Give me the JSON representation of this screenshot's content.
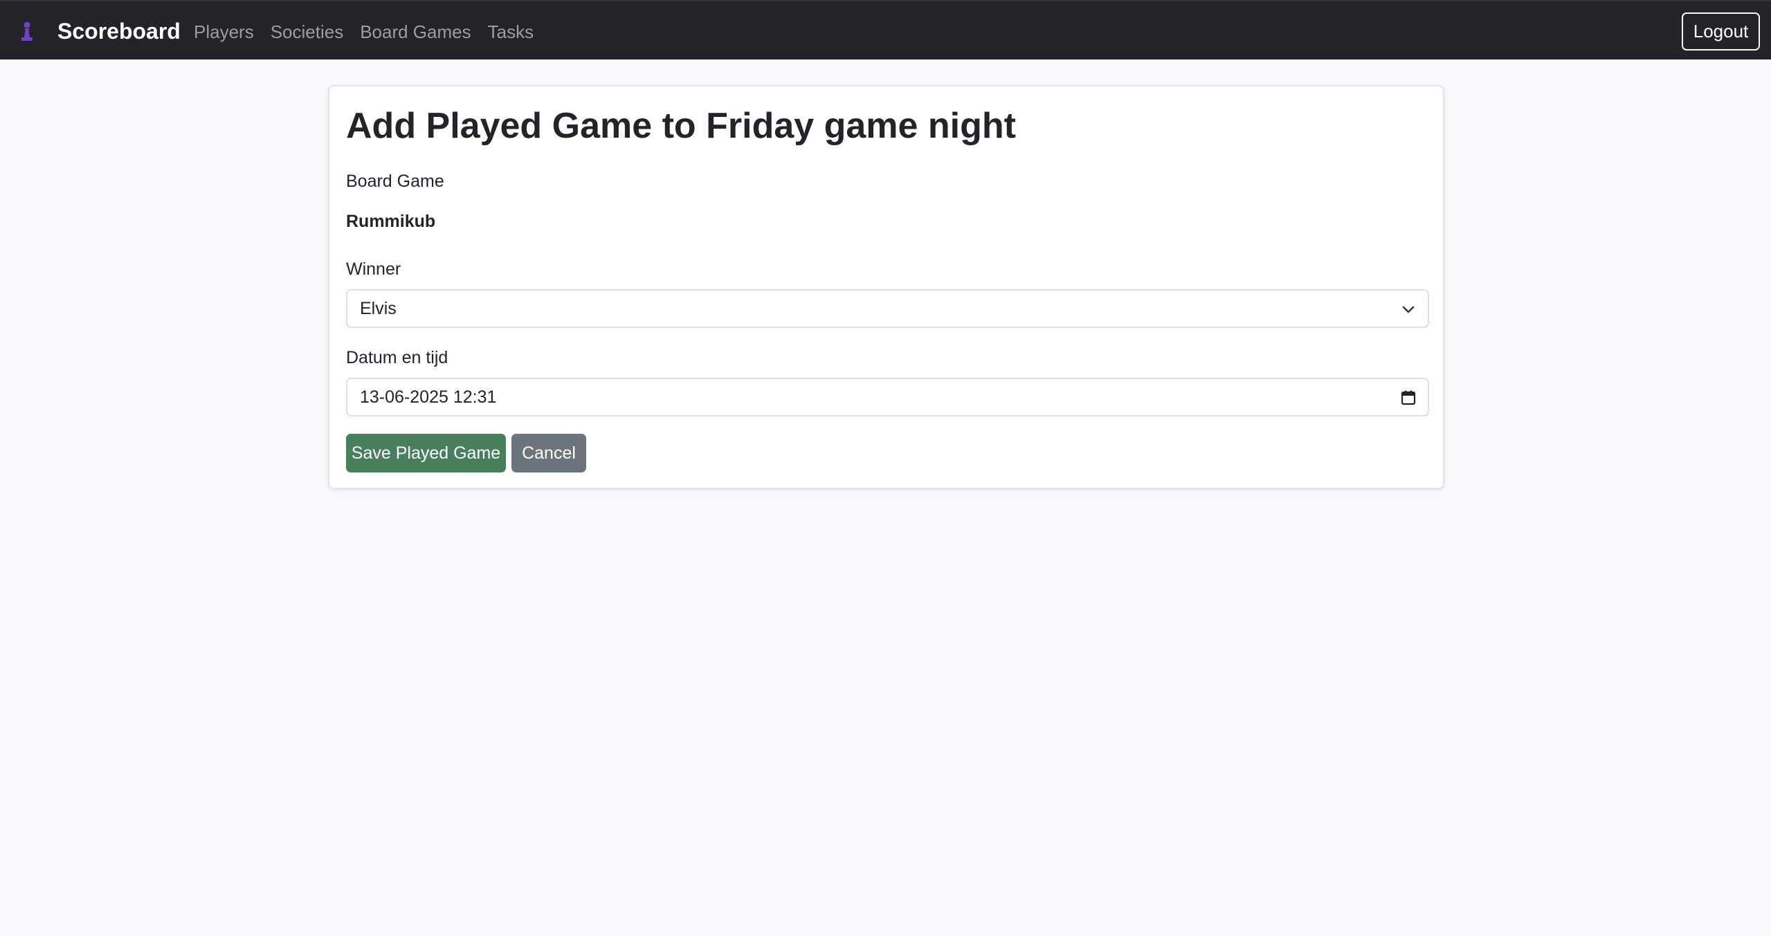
{
  "navbar": {
    "brand": "Scoreboard",
    "brand_icon": "chess-pawn-icon",
    "links": [
      "Players",
      "Societies",
      "Board Games",
      "Tasks"
    ],
    "logout_label": "Logout"
  },
  "form": {
    "title": "Add Played Game to Friday game night",
    "board_game_label": "Board Game",
    "board_game_value": "Rummikub",
    "winner_label": "Winner",
    "winner_value": "Elvis",
    "datetime_label": "Datum en tijd",
    "datetime_value": "13-06-2025 12:31",
    "save_label": "Save Played Game",
    "cancel_label": "Cancel"
  },
  "colors": {
    "navbar_bg": "#212529",
    "page_bg": "#f8f9fa",
    "save_button": "#48805c",
    "cancel_button": "#6c757d",
    "logo": "#6f42c1"
  }
}
